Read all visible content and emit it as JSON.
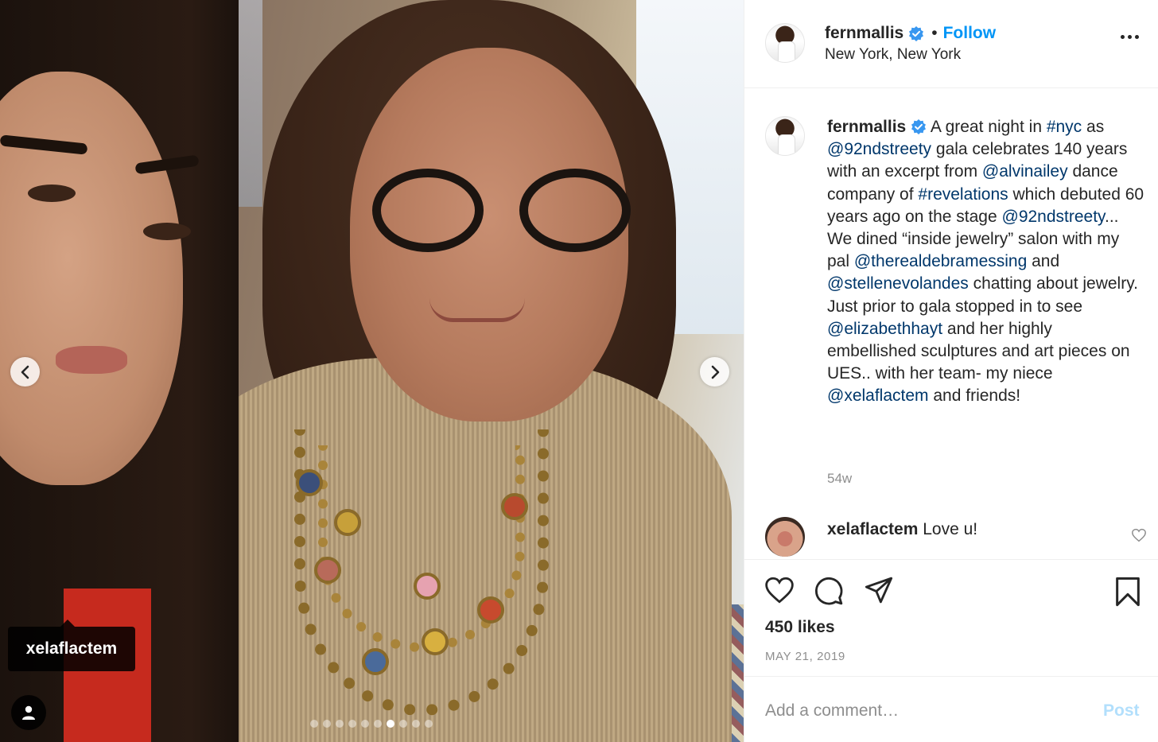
{
  "post": {
    "username": "fernmallis",
    "separator": "•",
    "follow_label": "Follow",
    "location": "New York, New York"
  },
  "photo": {
    "tag_label": "xelaflactem",
    "carousel": {
      "count": 10,
      "active_index": 6
    }
  },
  "caption": {
    "username": "fernmallis",
    "segments": [
      {
        "t": " A great night in "
      },
      {
        "t": "#nyc",
        "link": true
      },
      {
        "t": " as "
      },
      {
        "t": "@92ndstreety",
        "link": true
      },
      {
        "t": " gala celebrates 140 years with an excerpt from "
      },
      {
        "t": "@alvinailey",
        "link": true
      },
      {
        "t": " dance company of "
      },
      {
        "t": "#revelations",
        "link": true
      },
      {
        "t": " which debuted 60 years ago on the stage "
      },
      {
        "t": "@92ndstreety",
        "link": true
      },
      {
        "t": "... We dined “inside jewelry” salon with my pal "
      },
      {
        "t": "@therealdebramessing",
        "link": true
      },
      {
        "t": " and "
      },
      {
        "t": "@stellenevolandes",
        "link": true
      },
      {
        "t": " chatting about jewelry.\nJust prior to gala stopped in to see "
      },
      {
        "t": "@elizabethhayt",
        "link": true
      },
      {
        "t": " and her highly embellished sculptures and art pieces on UES.. with her team- my niece "
      },
      {
        "t": "@xelaflactem",
        "link": true
      },
      {
        "t": " and friends!"
      }
    ],
    "age": "54w"
  },
  "comments": [
    {
      "username": "xelaflactem",
      "text": "Love u!"
    }
  ],
  "actions": {
    "likes": "450 likes",
    "date": "MAY 21, 2019"
  },
  "composer": {
    "placeholder": "Add a comment…",
    "post_label": "Post"
  },
  "colors": {
    "link": "#00376b",
    "follow": "#0095f6",
    "verified": "#3897f0",
    "post_disabled": "#b2dffc",
    "muted": "#8e8e8e"
  },
  "icons": [
    "chevron-left-icon",
    "chevron-right-icon",
    "person-icon",
    "verified-badge-icon",
    "more-options-icon",
    "heart-icon",
    "comment-icon",
    "share-icon",
    "bookmark-icon"
  ]
}
